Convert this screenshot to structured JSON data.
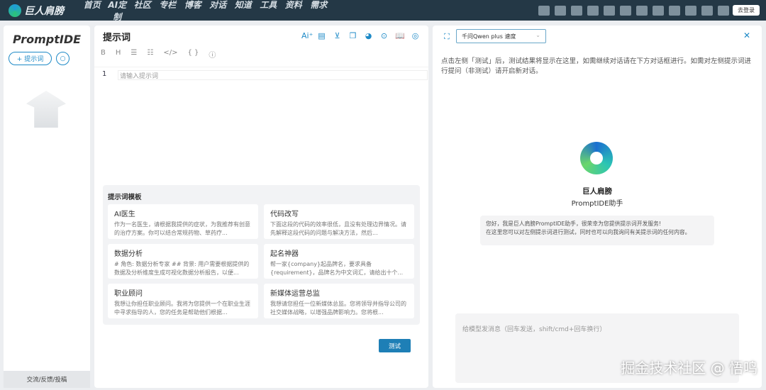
{
  "brand": {
    "name": "巨人肩膀"
  },
  "nav": [
    "首页",
    "AI定制",
    "社区",
    "专栏",
    "博客",
    "对话",
    "知道",
    "工具",
    "资料",
    "需求"
  ],
  "top_tools": [
    "markdown-icon",
    "html-to-md-icon",
    "md-to-html-icon",
    "excel-icon",
    "chart-icon",
    "edge-icon",
    "pie-icon",
    "org-chart-icon",
    "ai-chat-icon",
    "magic-wand-icon",
    "notebook-icon",
    "code-file-icon"
  ],
  "login": "去登录",
  "left": {
    "title": "PromptIDE",
    "add": "+ 提示词",
    "feedback": "交流/反馈/投稿"
  },
  "editor": {
    "title": "提示词",
    "toolbar_icons": [
      "Ai⁺",
      "▤",
      "⊻",
      "❐",
      "◕",
      "⊙",
      "📖",
      "◎"
    ],
    "format": [
      "B",
      "H",
      "☰",
      "☷",
      "</>",
      "{ }",
      "ⓘ"
    ],
    "line": "1",
    "placeholder": "请输入提示词"
  },
  "templates": {
    "title": "提示词模板",
    "items": [
      {
        "title": "AI医生",
        "desc": "作为一名医生，请根据我提供的症状，为我推荐有创意的治疗方案。你可以结合常规药物、草药疗..."
      },
      {
        "title": "代码改写",
        "desc": "下面这段的代码的效率很低，且没有处理边界情况。请先解释这段代码的问题与解决方法，然后..."
      },
      {
        "title": "数据分析",
        "desc": "# 角色: 数据分析专家 ## 背景: 用户需要根据提供的数据及分析维度生成可视化数据分析报告，以便..."
      },
      {
        "title": "起名神器",
        "desc": "帮一家{company}起品牌名，要求具备{requirement}，品牌名为中文词汇，请给出十个..."
      },
      {
        "title": "职业顾问",
        "desc": "我想让你担任职业顾问。我将为您提供一个在职业生涯中寻求指导的人，您的任务是帮助他们根据..."
      },
      {
        "title": "新媒体运营总监",
        "desc": "我想请您担任一位新媒体总监。您将领导并指导公司的社交媒体战略，以增强品牌影响力。您将根..."
      }
    ]
  },
  "test_button": "测试",
  "right": {
    "model": "千问Qwen plus 速度",
    "hint": "点击左侧「测试」后，测试结果将显示在这里，如需继续对话请在下方对话框进行。如需对左侧提示词进行提问（非测试）请开启新对话。",
    "bot_name": "巨人肩膀",
    "bot_sub": "PromptIDE助手",
    "greeting_1": "您好，我是巨人肩膀PromptIDE助手，很荣幸为您提供提示词开发服务!",
    "greeting_2": "在这里您可以对左侧提示词进行测试，同时也可以向我询问有关提示词的任何内容。",
    "chat_placeholder": "给模型发消息（回车发送，shift/cmd+回车换行）"
  },
  "watermark": "掘金技术社区 @ 悟鸣"
}
